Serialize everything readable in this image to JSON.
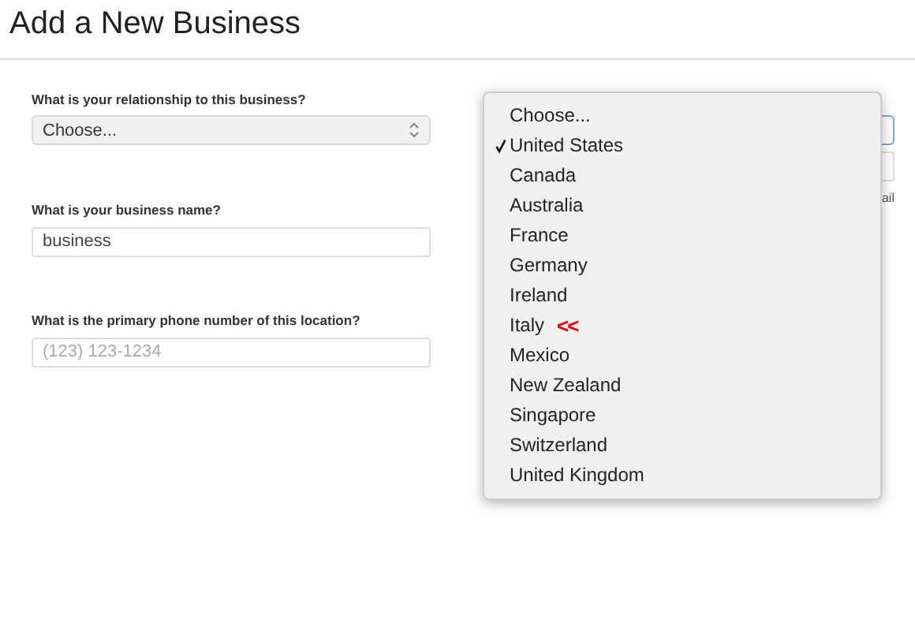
{
  "title": "Add a New Business",
  "left_fields": [
    {
      "kind": "select",
      "label": "What is your relationship to this business?",
      "value": "Choose..."
    },
    {
      "kind": "input",
      "label": "What is your business name?",
      "value": "business"
    },
    {
      "kind": "input",
      "label": "What is the primary phone number of this location?",
      "placeholder": "(123) 123-1234"
    }
  ],
  "right_column": {
    "note": "ail"
  },
  "country_menu": {
    "items": [
      {
        "label": "Choose...",
        "selected": false
      },
      {
        "label": "United States",
        "selected": true
      },
      {
        "label": "Canada",
        "selected": false
      },
      {
        "label": "Australia",
        "selected": false
      },
      {
        "label": "France",
        "selected": false
      },
      {
        "label": "Germany",
        "selected": false
      },
      {
        "label": "Ireland",
        "selected": false
      },
      {
        "label": "Italy",
        "selected": false,
        "annotation": "<<"
      },
      {
        "label": "Mexico",
        "selected": false
      },
      {
        "label": "New Zealand",
        "selected": false
      },
      {
        "label": "Singapore",
        "selected": false
      },
      {
        "label": "Switzerland",
        "selected": false
      },
      {
        "label": "United Kingdom",
        "selected": false
      }
    ]
  }
}
